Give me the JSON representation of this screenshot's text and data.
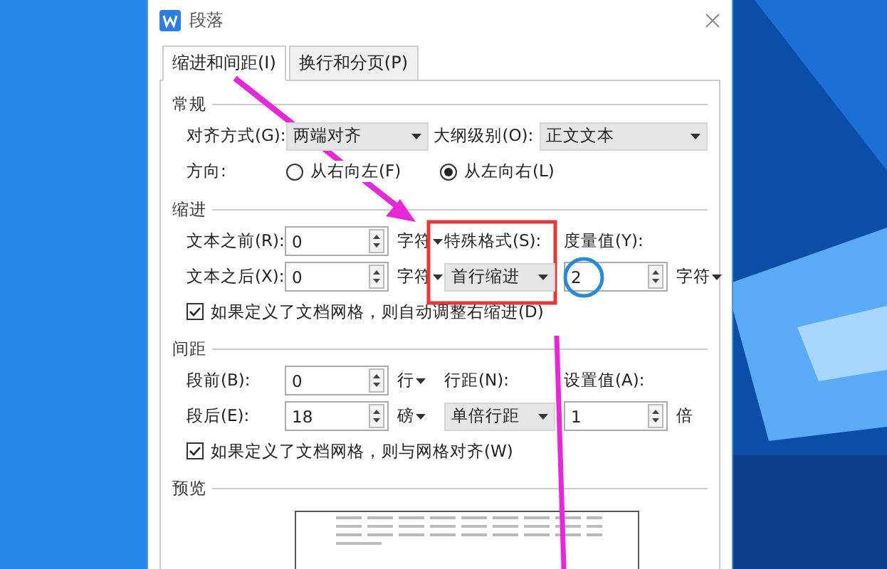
{
  "window": {
    "title": "段落"
  },
  "tabs": [
    {
      "label": "缩进和间距(I)",
      "selected": true
    },
    {
      "label": "换行和分页(P)",
      "selected": false
    }
  ],
  "general": {
    "title": "常规",
    "alignment": {
      "label": "对齐方式(G):",
      "value": "两端对齐"
    },
    "outline": {
      "label": "大纲级别(O):",
      "value": "正文文本"
    },
    "direction": {
      "label": "方向:",
      "options": [
        {
          "label": "从右向左(F)",
          "selected": false
        },
        {
          "label": "从左向右(L)",
          "selected": true
        }
      ]
    }
  },
  "indent": {
    "title": "缩进",
    "before": {
      "label": "文本之前(R):",
      "value": "0",
      "unit": "字符"
    },
    "after": {
      "label": "文本之后(X):",
      "value": "0",
      "unit": "字符"
    },
    "special": {
      "label": "特殊格式(S):",
      "value": "首行缩进"
    },
    "measure": {
      "label": "度量值(Y):",
      "value": "2",
      "unit": "字符"
    },
    "grid_option": {
      "label": "如果定义了文档网格，则自动调整右缩进(D)",
      "checked": true
    }
  },
  "spacing": {
    "title": "间距",
    "before": {
      "label": "段前(B):",
      "value": "0",
      "unit": "行"
    },
    "after": {
      "label": "段后(E):",
      "value": "18",
      "unit": "磅"
    },
    "line": {
      "label": "行距(N):",
      "value": "单倍行距"
    },
    "setting": {
      "label": "设置值(A):",
      "value": "1",
      "unit": "倍"
    },
    "grid_option": {
      "label": "如果定义了文档网格，则与网格对齐(W)",
      "checked": true
    }
  },
  "preview": {
    "title": "预览"
  }
}
